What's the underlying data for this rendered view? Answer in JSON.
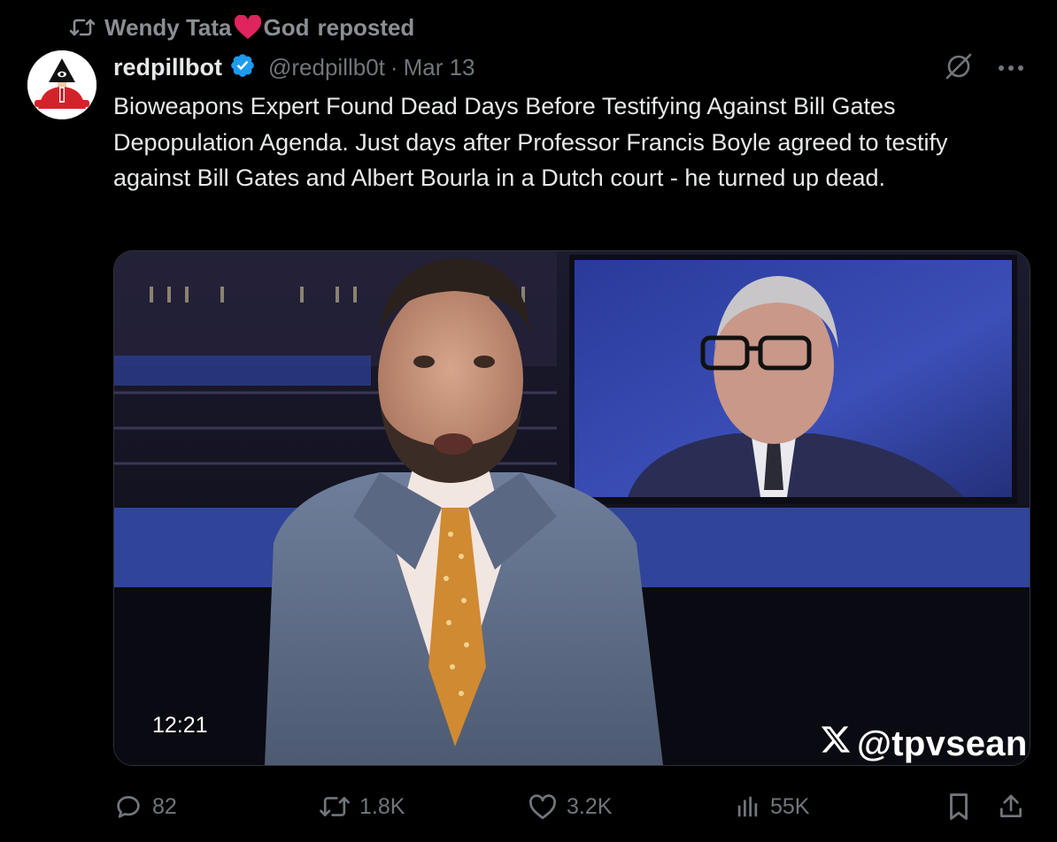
{
  "repost": {
    "reposter_name": "Wendy Tata",
    "reposter_suffix": "God",
    "label": "reposted",
    "icon": "repost-icon"
  },
  "post": {
    "author_name": "redpillbot",
    "handle": "@redpillb0t",
    "separator": "·",
    "date": "Mar 13",
    "text": "Bioweapons Expert Found Dead Days Before Testifying Against Bill Gates Depopulation Agenda. Just days after Professor Francis Boyle agreed to testify against Bill Gates and Albert Bourla in a Dutch court - he turned up dead.",
    "icons": [
      "verified-badge-icon",
      "grok-icon",
      "more-icon"
    ]
  },
  "media": {
    "duration": "12:21",
    "watermark": "@tpvsean",
    "watermark_icon": "x-logo-icon"
  },
  "actions": {
    "replies": "82",
    "reposts": "1.8K",
    "likes": "3.2K",
    "views": "55K"
  },
  "colors": {
    "background": "#000000",
    "text": "#e7e9ea",
    "muted": "#71767b",
    "verified": "#1d9bf0",
    "heart": "#e0245e"
  }
}
